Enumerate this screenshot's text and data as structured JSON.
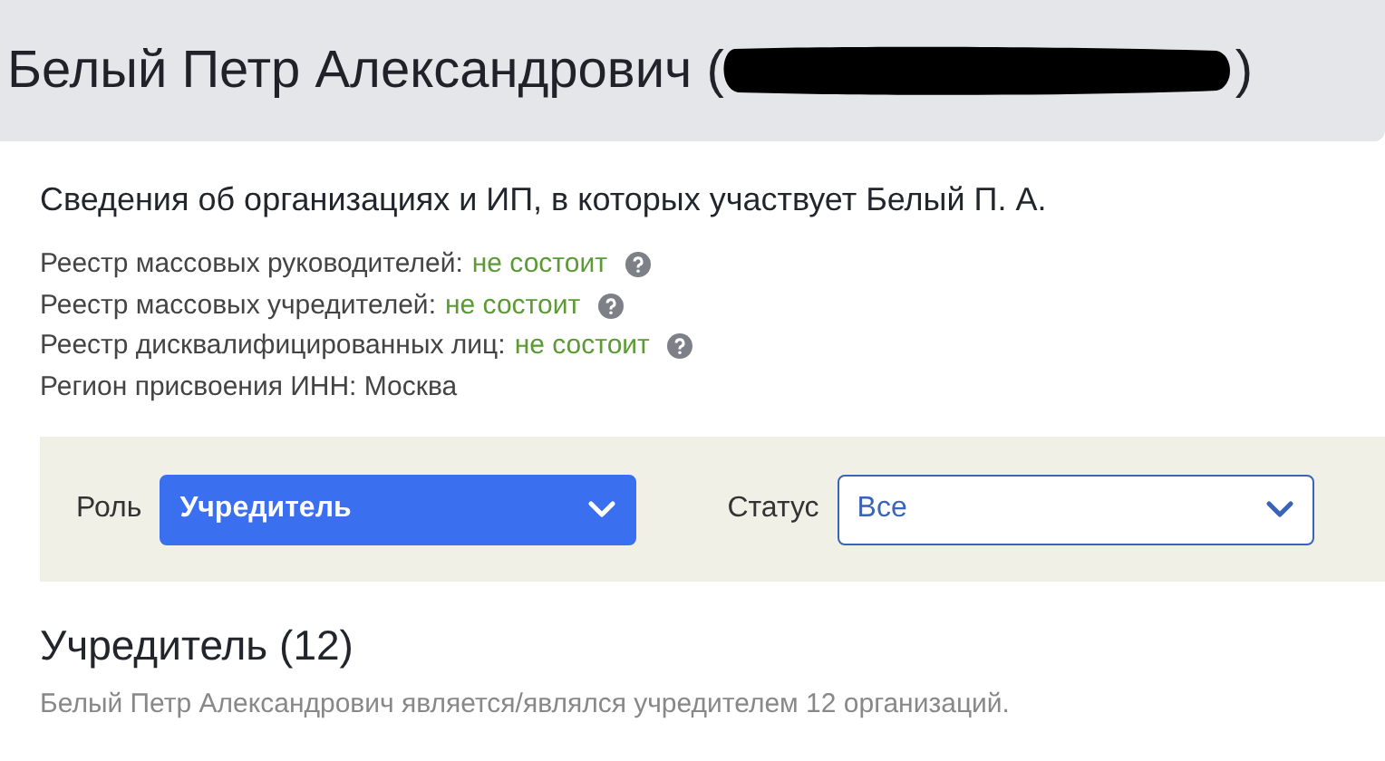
{
  "header": {
    "title_start": "Белый Петр Александрович (",
    "redacted": true,
    "title_end": ")"
  },
  "subtitle": "Сведения об организациях и ИП, в которых участвует Белый П. А.",
  "facts": [
    {
      "label": "Реестр массовых руководителей:",
      "value": "не состоит",
      "help": true
    },
    {
      "label": "Реестр массовых учредителей:",
      "value": "не состоит",
      "help": true
    },
    {
      "label": "Реестр дисквалифицированных лиц:",
      "value": "не состоит",
      "help": true
    },
    {
      "label": "Регион присвоения ИНН: Москва",
      "help": false
    }
  ],
  "filters": [
    {
      "label": "Роль",
      "value": "Учредитель",
      "active": true
    },
    {
      "label": "Статус",
      "value": "Все",
      "active": false
    }
  ],
  "section": {
    "title": "Учредитель (12)",
    "note": "Белый Петр Александрович является/являлся учредителем 12 организаций."
  }
}
